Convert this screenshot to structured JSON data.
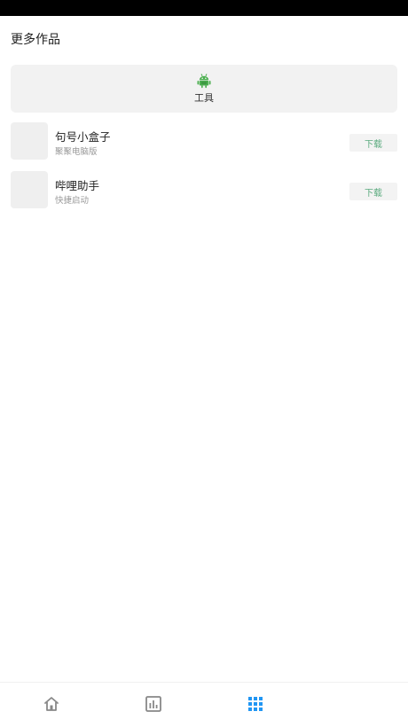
{
  "header": {
    "title": "更多作品"
  },
  "category": {
    "label": "工具",
    "icon": "android-icon",
    "icon_color": "#4caf50"
  },
  "apps": [
    {
      "name": "句号小盒子",
      "desc": "聚聚电脑版",
      "action": "下载"
    },
    {
      "name": "哔哩助手",
      "desc": "快捷启动",
      "action": "下载"
    }
  ],
  "nav": {
    "items": [
      {
        "icon": "home-icon",
        "active": false
      },
      {
        "icon": "bar-chart-icon",
        "active": false
      },
      {
        "icon": "grid-icon",
        "active": true
      }
    ],
    "active_color": "#2196f3",
    "inactive_color": "#888888"
  },
  "colors": {
    "download_text": "#5aaa7e",
    "card_bg": "#f2f2f2"
  }
}
